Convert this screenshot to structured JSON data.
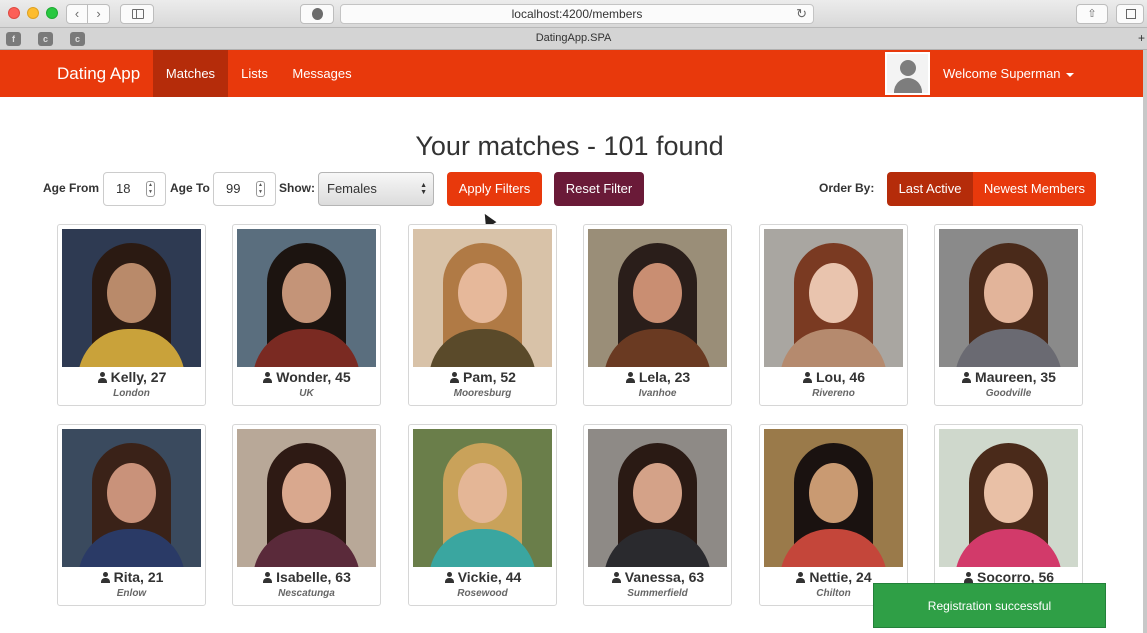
{
  "browser": {
    "url": "localhost:4200/members",
    "tab_title": "DatingApp.SPA",
    "back_glyph": "‹",
    "forward_glyph": "›",
    "reload_glyph": "↻",
    "share_glyph": "⇧",
    "new_tab_glyph": "+",
    "favicons": [
      {
        "label": "f",
        "icon": "facebook-icon"
      },
      {
        "label": "c",
        "icon": "bookmark-icon"
      },
      {
        "label": "c",
        "icon": "bookmark-icon"
      }
    ]
  },
  "navbar": {
    "brand": "Dating App",
    "links": [
      {
        "label": "Matches",
        "active": true
      },
      {
        "label": "Lists",
        "active": false
      },
      {
        "label": "Messages",
        "active": false
      }
    ],
    "welcome": "Welcome Superman",
    "avatar_icon": "user-placeholder-icon"
  },
  "heading": "Your matches - 101 found",
  "filters": {
    "age_from_label": "Age From",
    "age_from_value": "18",
    "age_to_label": "Age To",
    "age_to_value": "99",
    "show_label": "Show:",
    "show_value": "Females",
    "apply_label": "Apply Filters",
    "reset_label": "Reset Filter",
    "order_by_label": "Order By:",
    "order_options": [
      {
        "label": "Last Active",
        "active": true
      },
      {
        "label": "Newest Members",
        "active": false
      }
    ]
  },
  "members": [
    {
      "name_age": "Kelly, 27",
      "city": "London",
      "colors": {
        "bg": "#2e3a52",
        "hair": "#2b1a12",
        "face": "#b98a6a",
        "body": "#c9a23a"
      }
    },
    {
      "name_age": "Wonder, 45",
      "city": "UK",
      "colors": {
        "bg": "#5a6e7e",
        "hair": "#1c1410",
        "face": "#c49478",
        "body": "#7a2a22"
      }
    },
    {
      "name_age": "Pam, 52",
      "city": "Mooresburg",
      "colors": {
        "bg": "#d8c2a8",
        "hair": "#b07a45",
        "face": "#e6b89a",
        "body": "#5a4a2a"
      }
    },
    {
      "name_age": "Lela, 23",
      "city": "Ivanhoe",
      "colors": {
        "bg": "#9a8e78",
        "hair": "#2a1e1a",
        "face": "#c98e72",
        "body": "#6a3a22"
      }
    },
    {
      "name_age": "Lou, 46",
      "city": "Rivereno",
      "colors": {
        "bg": "#a9a6a1",
        "hair": "#7a3a22",
        "face": "#e9c4ae",
        "body": "#b58a6e"
      }
    },
    {
      "name_age": "Maureen, 35",
      "city": "Goodville",
      "colors": {
        "bg": "#8a8a8a",
        "hair": "#4a2a1a",
        "face": "#e2b49a",
        "body": "#6a6a72"
      }
    },
    {
      "name_age": "Rita, 21",
      "city": "Enlow",
      "colors": {
        "bg": "#3a4a5e",
        "hair": "#3a2218",
        "face": "#c9927a",
        "body": "#2a3a66"
      }
    },
    {
      "name_age": "Isabelle, 63",
      "city": "Nescatunga",
      "colors": {
        "bg": "#b8a898",
        "hair": "#2e1a14",
        "face": "#d9a88e",
        "body": "#5a2a3a"
      }
    },
    {
      "name_age": "Vickie, 44",
      "city": "Rosewood",
      "colors": {
        "bg": "#6a7e4a",
        "hair": "#c9a25a",
        "face": "#e4b696",
        "body": "#3aa6a0"
      }
    },
    {
      "name_age": "Vanessa, 63",
      "city": "Summerfield",
      "colors": {
        "bg": "#8e8a86",
        "hair": "#2a1a14",
        "face": "#d4a288",
        "body": "#2a2a2e"
      }
    },
    {
      "name_age": "Nettie, 24",
      "city": "Chilton",
      "colors": {
        "bg": "#9a7a4a",
        "hair": "#1a1210",
        "face": "#c99a72",
        "body": "#c4463a"
      }
    },
    {
      "name_age": "Socorro, 56",
      "city": "",
      "colors": {
        "bg": "#cfd8cc",
        "hair": "#4a2a1a",
        "face": "#e9c0a6",
        "body": "#d23a6a"
      }
    }
  ],
  "toast": "Registration successful",
  "colors": {
    "primary": "#e8390c",
    "primary_dark": "#b52c0a",
    "reset": "#6a1a38",
    "toast": "#2f9f46"
  }
}
